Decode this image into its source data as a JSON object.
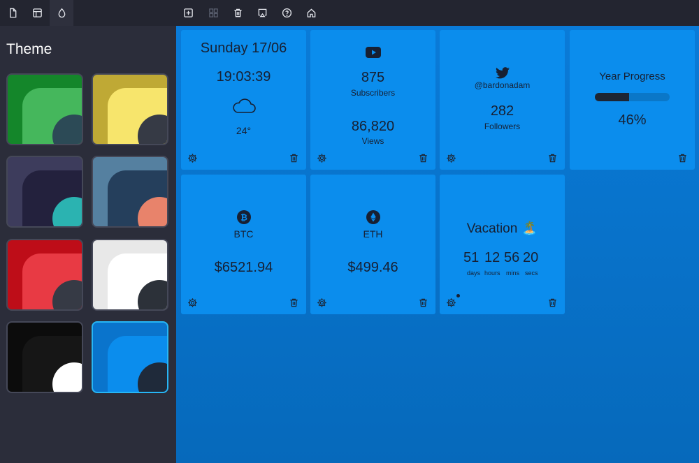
{
  "sidebar": {
    "title": "Theme",
    "themes": [
      {
        "bg": "#14862a",
        "inner": "#45b75c",
        "dot": "#2c4a56"
      },
      {
        "bg": "#bfa935",
        "inner": "#f7e56c",
        "dot": "#363a45"
      },
      {
        "bg": "#3d3c5c",
        "inner": "#23213d",
        "dot": "#2bb3b1"
      },
      {
        "bg": "#5580a0",
        "inner": "#253f5c",
        "dot": "#e8836b"
      },
      {
        "bg": "#be0d18",
        "inner": "#e83a44",
        "dot": "#363a45"
      },
      {
        "bg": "#e8e8e8",
        "inner": "#ffffff",
        "dot": "#2c3139"
      },
      {
        "bg": "#0c0c0c",
        "inner": "#161616",
        "dot": "#ffffff"
      },
      {
        "bg": "#0a74cc",
        "inner": "#0b8ded",
        "dot": "#1f2a3a"
      }
    ]
  },
  "cards": {
    "date": {
      "day": "Sunday 17/06",
      "time": "19:03:39",
      "temp": "24°"
    },
    "youtube": {
      "subscribers": "875",
      "subscribers_label": "Subscribers",
      "views": "86,820",
      "views_label": "Views"
    },
    "twitter": {
      "handle": "@bardonadam",
      "followers": "282",
      "followers_label": "Followers"
    },
    "progress": {
      "title": "Year Progress",
      "percent_text": "46%",
      "percent": 0.46
    },
    "btc": {
      "label": "BTC",
      "price": "$6521.94"
    },
    "eth": {
      "label": "ETH",
      "price": "$499.46"
    },
    "vacation": {
      "title": "Vacation 🏝️",
      "days": "51",
      "hours": "12",
      "mins": "56",
      "secs": "20",
      "days_label": "days",
      "hours_label": "hours",
      "mins_label": "mins",
      "secs_label": "secs"
    }
  }
}
